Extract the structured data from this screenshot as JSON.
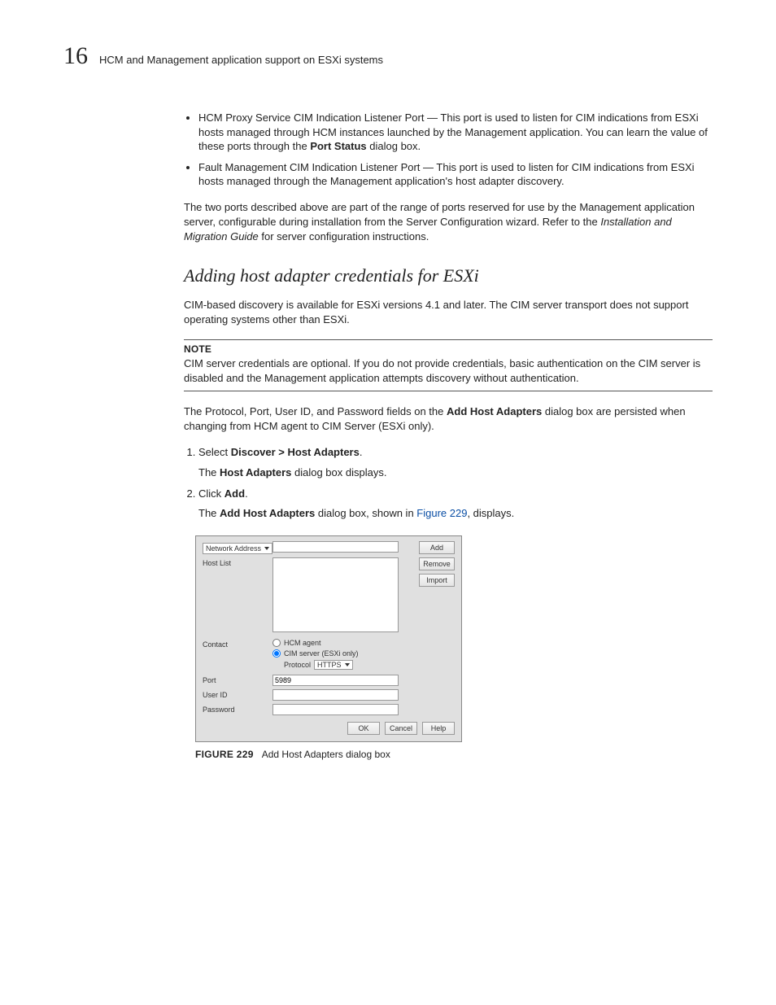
{
  "header": {
    "chapter_number": "16",
    "title": "HCM and Management application support on ESXi systems"
  },
  "bullets": [
    {
      "prefix": "HCM Proxy Service CIM Indication Listener Port — This port is used to listen for CIM indications from ESXi hosts managed through HCM instances launched by the Management application. You can learn the value of these ports through the ",
      "bold": "Port Status",
      "suffix": " dialog box."
    },
    {
      "text": "Fault Management CIM Indication Listener Port — This port is used to listen for CIM indications from ESXi hosts managed through the Management application's host adapter discovery."
    }
  ],
  "para_ports": {
    "before": "The two ports described above are part of the range of ports reserved for use by the Management application server, configurable during installation from the Server Configuration wizard. Refer to the ",
    "italic": "Installation and Migration Guide",
    "after": " for server configuration instructions."
  },
  "section_heading": "Adding host adapter credentials for ESXi",
  "para_cim": "CIM-based discovery is available for ESXi versions 4.1 and later. The CIM server transport does not support operating systems other than ESXi.",
  "note": {
    "label": "NOTE",
    "text": "CIM server credentials are optional. If you do not provide credentials, basic authentication on the CIM server is disabled and the Management application attempts discovery without authentication."
  },
  "para_persist": {
    "before": "The Protocol, Port, User ID, and Password fields on the ",
    "bold": "Add Host Adapters",
    "after": " dialog box are persisted when changing from HCM agent to CIM Server (ESXi only)."
  },
  "steps": {
    "s1_before": "Select ",
    "s1_bold": "Discover > Host Adapters",
    "s1_after": ".",
    "s1_sub_before": "The ",
    "s1_sub_bold": "Host Adapters",
    "s1_sub_after": " dialog box displays.",
    "s2_before": "Click ",
    "s2_bold": "Add",
    "s2_after": ".",
    "s2_sub_before": "The ",
    "s2_sub_bold": "Add Host Adapters",
    "s2_sub_mid": " dialog box, shown in ",
    "s2_sub_link": "Figure 229",
    "s2_sub_after": ", displays."
  },
  "dialog": {
    "network_address_label": "Network Address",
    "host_list_label": "Host List",
    "contact_label": "Contact",
    "hcm_agent_label": "HCM agent",
    "cim_server_label": "CIM server (ESXi only)",
    "protocol_label": "Protocol",
    "protocol_value": "HTTPS",
    "port_label": "Port",
    "port_value": "5989",
    "userid_label": "User ID",
    "password_label": "Password",
    "btn_add": "Add",
    "btn_remove": "Remove",
    "btn_import": "Import",
    "btn_ok": "OK",
    "btn_cancel": "Cancel",
    "btn_help": "Help"
  },
  "figure": {
    "number": "FIGURE 229",
    "caption": "Add Host Adapters dialog box"
  }
}
